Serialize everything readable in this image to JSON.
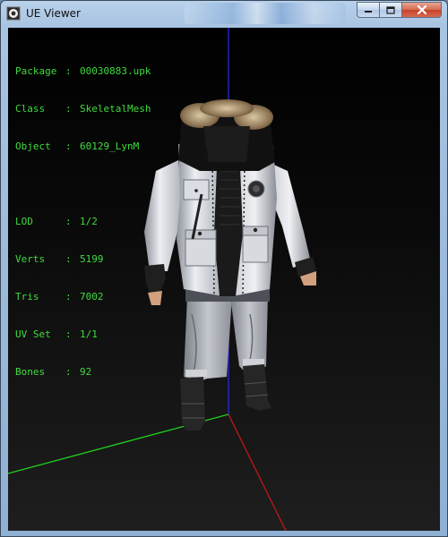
{
  "window": {
    "title": "UE Viewer",
    "controls": {
      "minimize": "minimize",
      "maximize": "maximize",
      "close": "close"
    }
  },
  "info": {
    "package": {
      "label": "Package",
      "value": "00030883.upk"
    },
    "class": {
      "label": "Class",
      "value": "SkeletalMesh"
    },
    "object": {
      "label": "Object",
      "value": "60129_LynM"
    },
    "lod": {
      "label": "LOD",
      "value": "1/2"
    },
    "verts": {
      "label": "Verts",
      "value": "5199"
    },
    "tris": {
      "label": "Tris",
      "value": "7002"
    },
    "uvset": {
      "label": "UV Set",
      "value": "1/1"
    },
    "bones": {
      "label": "Bones",
      "value": "92"
    },
    "separator": ":"
  },
  "colors": {
    "info_text": "#3fdc3f",
    "axis_x": "#c01818",
    "axis_y": "#1fd21f",
    "axis_z": "#2626e0",
    "viewport_bg": "#141414"
  },
  "icons": [
    "ue-viewer-app-icon",
    "minimize-icon",
    "maximize-icon",
    "close-icon"
  ],
  "scene": {
    "model": "skeletal-mesh-character",
    "axes": [
      "x",
      "y",
      "z"
    ]
  }
}
